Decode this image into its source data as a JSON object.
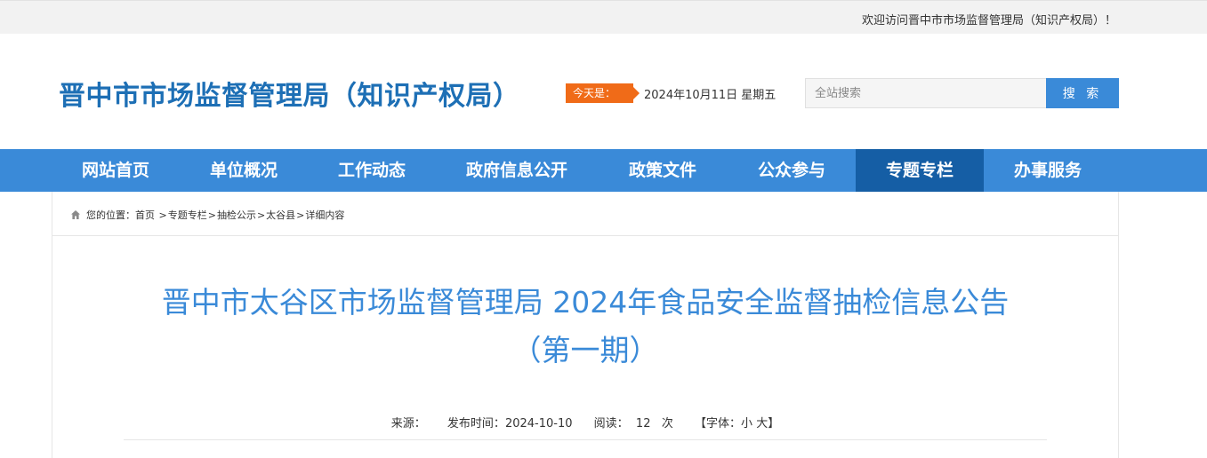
{
  "topbar": {
    "welcome": "欢迎访问晋中市市场监督管理局（知识产权局）！"
  },
  "header": {
    "site_title": "晋中市市场监督管理局（知识产权局）",
    "today_label": "今天是：",
    "today_date": "2024年10月11日 星期五",
    "search_placeholder": "全站搜索",
    "search_button": "搜 索"
  },
  "nav": {
    "items": [
      {
        "label": "网站首页",
        "active": false
      },
      {
        "label": "单位概况",
        "active": false
      },
      {
        "label": "工作动态",
        "active": false
      },
      {
        "label": "政府信息公开",
        "active": false
      },
      {
        "label": "政策文件",
        "active": false
      },
      {
        "label": "公众参与",
        "active": false
      },
      {
        "label": "专题专栏",
        "active": true
      },
      {
        "label": "办事服务",
        "active": false
      }
    ]
  },
  "breadcrumb": {
    "prefix": "您的位置：",
    "items": [
      "首页",
      "专题专栏",
      "抽检公示",
      "太谷县",
      "详细内容"
    ]
  },
  "article": {
    "title_line1": "晋中市太谷区市场监督管理局 2024年食品安全监督抽检信息公告",
    "title_line2": "（第一期）",
    "source_label": "来源：",
    "publish_label": "发布时间：",
    "publish_date": "2024-10-10",
    "views_label": "阅读：",
    "views_count": "12",
    "views_unit": "次",
    "font_label": "【字体：",
    "font_small": "小",
    "font_large": "大",
    "font_suffix": "】"
  },
  "colors": {
    "primary": "#3a8ad8",
    "nav_active": "#155ea5",
    "title_blue": "#1d6fb5",
    "accent_orange": "#f06b18"
  }
}
